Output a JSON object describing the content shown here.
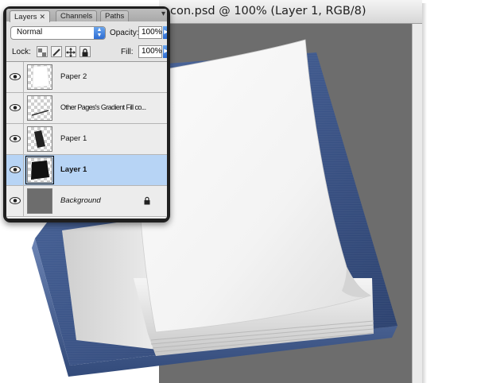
{
  "document": {
    "title": "con.psd @ 100% (Layer 1, RGB/8)",
    "canvas_color": "#6d6d6d"
  },
  "layers_panel": {
    "tabs": [
      {
        "label": "Layers",
        "active": true
      },
      {
        "label": "Channels",
        "active": false
      },
      {
        "label": "Paths",
        "active": false
      }
    ],
    "blend_mode": "Normal",
    "opacity_label": "Opacity:",
    "opacity_value": "100%",
    "lock_label": "Lock:",
    "fill_label": "Fill:",
    "fill_value": "100%",
    "layers": [
      {
        "name": "Paper 2",
        "visible": true,
        "selected": false,
        "locked": false
      },
      {
        "name": "Other Pages's Gradient Fill co...",
        "visible": true,
        "selected": false,
        "locked": false
      },
      {
        "name": "Paper 1",
        "visible": true,
        "selected": false,
        "locked": false
      },
      {
        "name": "Layer 1",
        "visible": true,
        "selected": true,
        "locked": false
      },
      {
        "name": "Background",
        "visible": true,
        "selected": false,
        "locked": true
      }
    ]
  },
  "colors": {
    "selection": "#b7d4f5",
    "accent_blue": "#3a78dc",
    "notebook_cover": "#37507f"
  }
}
